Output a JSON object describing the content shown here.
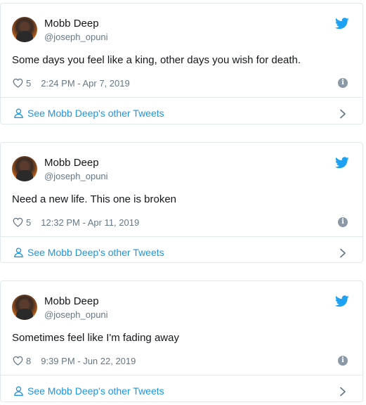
{
  "tweets": [
    {
      "author_name": "Mobb Deep",
      "handle": "@joseph_opuni",
      "text": "Some days you feel like a king, other days you wish for death.",
      "likes": "5",
      "timestamp": "2:24 PM - Apr 7, 2019",
      "more_label": "See Mobb Deep's other Tweets"
    },
    {
      "author_name": "Mobb Deep",
      "handle": "@joseph_opuni",
      "text": "Need a new life. This one is broken",
      "likes": "5",
      "timestamp": "12:32 PM - Apr 11, 2019",
      "more_label": "See Mobb Deep's other Tweets"
    },
    {
      "author_name": "Mobb Deep",
      "handle": "@joseph_opuni",
      "text": "Sometimes feel like I'm fading away",
      "likes": "8",
      "timestamp": "9:39 PM - Jun 22, 2019",
      "more_label": "See Mobb Deep's other Tweets"
    }
  ],
  "icons": {
    "brand": "twitter-bird-icon",
    "like": "heart-icon",
    "info": "info-icon",
    "profile": "person-icon",
    "chevron": "chevron-right-icon"
  },
  "colors": {
    "twitter_blue": "#1da1f2",
    "link_blue": "#1b95e0",
    "secondary_text": "#657786",
    "border": "#e1e8ed"
  }
}
